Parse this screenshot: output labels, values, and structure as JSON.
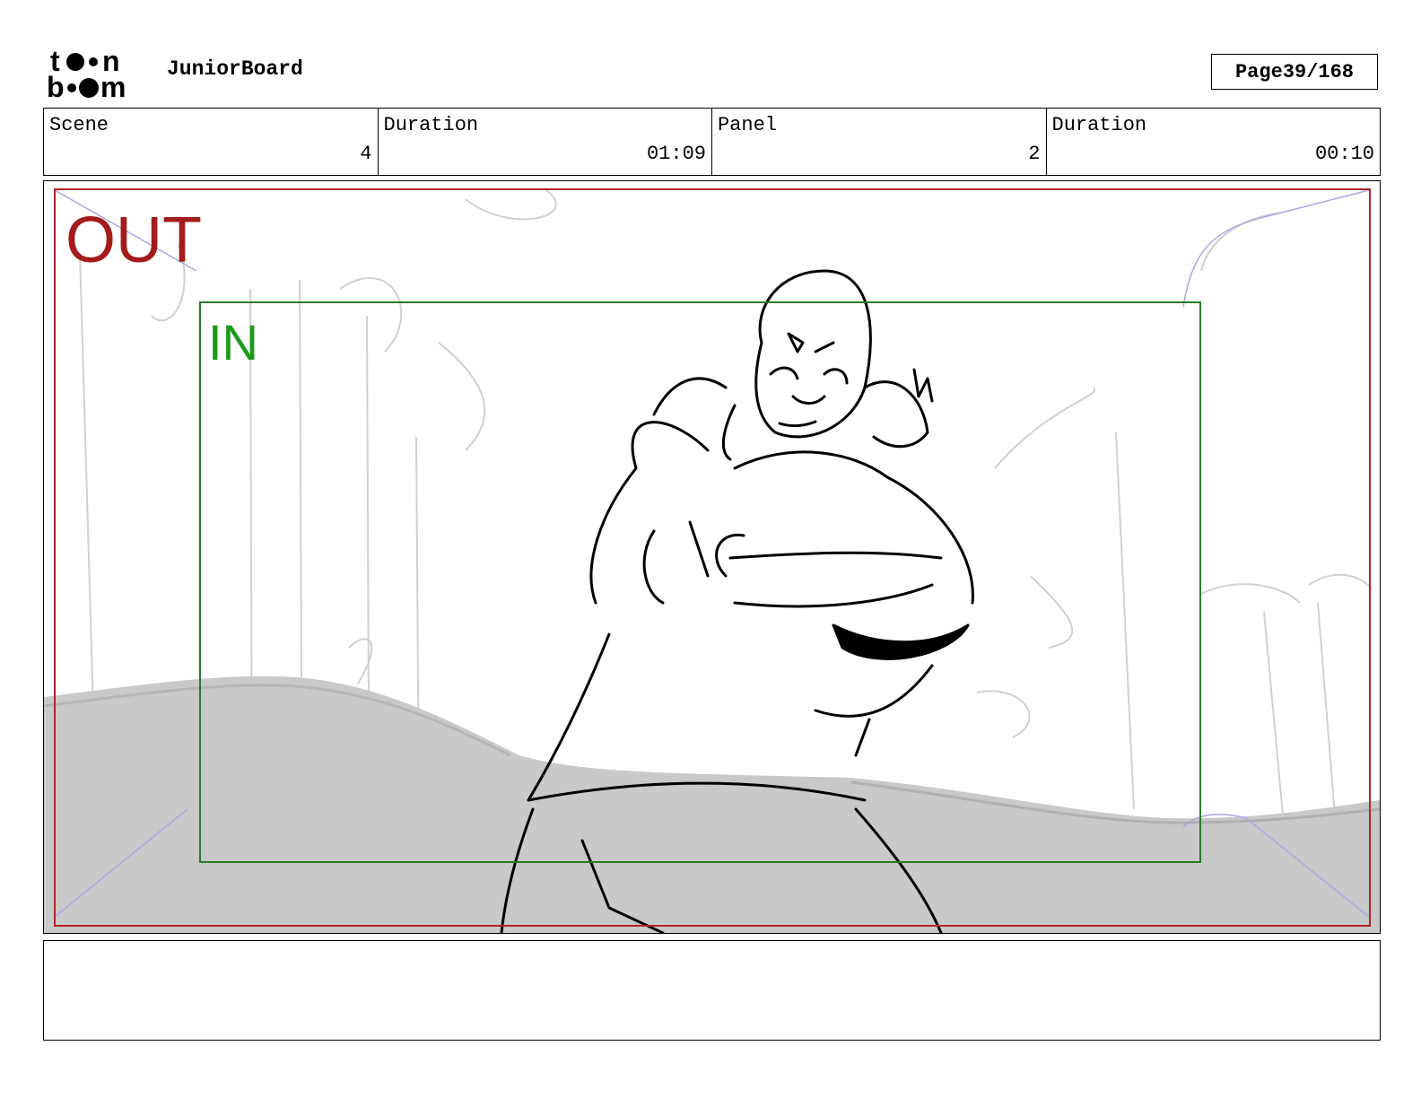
{
  "header": {
    "logo_alt": "toon boom",
    "app_title": "JuniorBoard",
    "page_label": "Page",
    "page_value": "39/168"
  },
  "info": {
    "scene_label": "Scene",
    "scene_value": "4",
    "scene_duration_label": "Duration",
    "scene_duration_value": "01:09",
    "panel_label": "Panel",
    "panel_value": "2",
    "panel_duration_label": "Duration",
    "panel_duration_value": "00:10"
  },
  "panel": {
    "out_label": "OUT",
    "in_label": "IN",
    "out_color": "#b32424",
    "in_color": "#2a7a2a"
  },
  "notes": {
    "text": ""
  }
}
